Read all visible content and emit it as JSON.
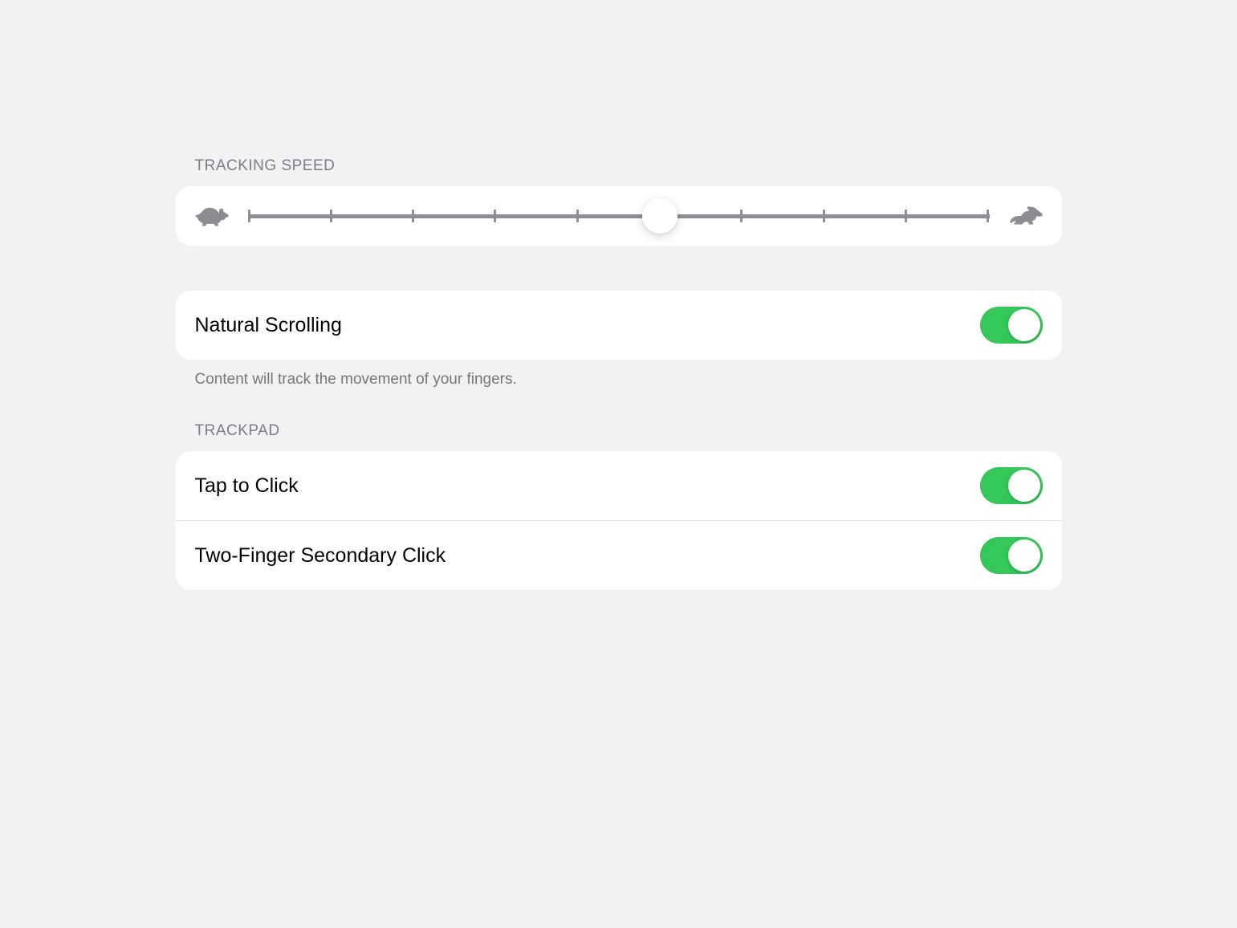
{
  "trackingSpeed": {
    "header": "TRACKING SPEED",
    "value": 5,
    "min": 0,
    "max": 9,
    "ticks": 10
  },
  "naturalScrolling": {
    "label": "Natural Scrolling",
    "enabled": true,
    "footer": "Content will track the movement of your fingers."
  },
  "trackpad": {
    "header": "TRACKPAD",
    "tapToClick": {
      "label": "Tap to Click",
      "enabled": true
    },
    "twoFingerSecondary": {
      "label": "Two-Finger Secondary Click",
      "enabled": true
    }
  }
}
